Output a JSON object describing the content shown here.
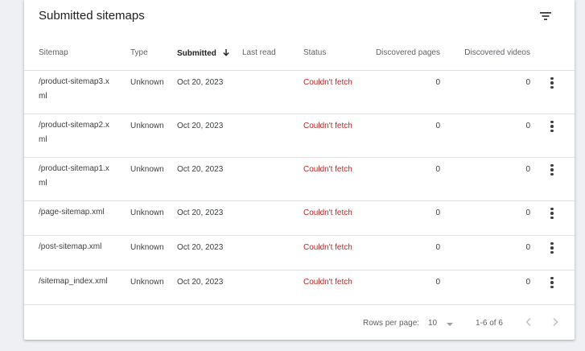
{
  "card": {
    "title": "Submitted sitemaps",
    "filter_icon": "filter-icon"
  },
  "table": {
    "columns": {
      "sitemap": "Sitemap",
      "type": "Type",
      "submitted": "Submitted",
      "last_read": "Last read",
      "status": "Status",
      "discovered_pages": "Discovered pages",
      "discovered_videos": "Discovered videos"
    },
    "sort": {
      "column": "submitted",
      "direction": "descending",
      "icon": "arrow-down-icon"
    },
    "rows": [
      {
        "sitemap": "/product-sitemap3.xml",
        "type": "Unknown",
        "submitted": "Oct 20, 2023",
        "last_read": "",
        "status": "Couldn't fetch",
        "discovered_pages": "0",
        "discovered_videos": "0"
      },
      {
        "sitemap": "/product-sitemap2.xml",
        "type": "Unknown",
        "submitted": "Oct 20, 2023",
        "last_read": "",
        "status": "Couldn't fetch",
        "discovered_pages": "0",
        "discovered_videos": "0"
      },
      {
        "sitemap": "/product-sitemap1.xml",
        "type": "Unknown",
        "submitted": "Oct 20, 2023",
        "last_read": "",
        "status": "Couldn't fetch",
        "discovered_pages": "0",
        "discovered_videos": "0"
      },
      {
        "sitemap": "/page-sitemap.xml",
        "type": "Unknown",
        "submitted": "Oct 20, 2023",
        "last_read": "",
        "status": "Couldn't fetch",
        "discovered_pages": "0",
        "discovered_videos": "0"
      },
      {
        "sitemap": "/post-sitemap.xml",
        "type": "Unknown",
        "submitted": "Oct 20, 2023",
        "last_read": "",
        "status": "Couldn't fetch",
        "discovered_pages": "0",
        "discovered_videos": "0"
      },
      {
        "sitemap": "/sitemap_index.xml",
        "type": "Unknown",
        "submitted": "Oct 20, 2023",
        "last_read": "",
        "status": "Couldn't fetch",
        "discovered_pages": "0",
        "discovered_videos": "0"
      }
    ],
    "row_menu_icon": "more-vert-icon"
  },
  "pagination": {
    "rows_per_page_label": "Rows per page:",
    "rows_per_page": "10",
    "range": "1-6 of 6",
    "prev_icon": "chevron-left-icon",
    "next_icon": "chevron-right-icon"
  },
  "colors": {
    "error": "#c5221f",
    "text": "#202124",
    "muted": "#5f6368",
    "divider": "#e0e0e0",
    "disabled": "#bdc1c6"
  }
}
